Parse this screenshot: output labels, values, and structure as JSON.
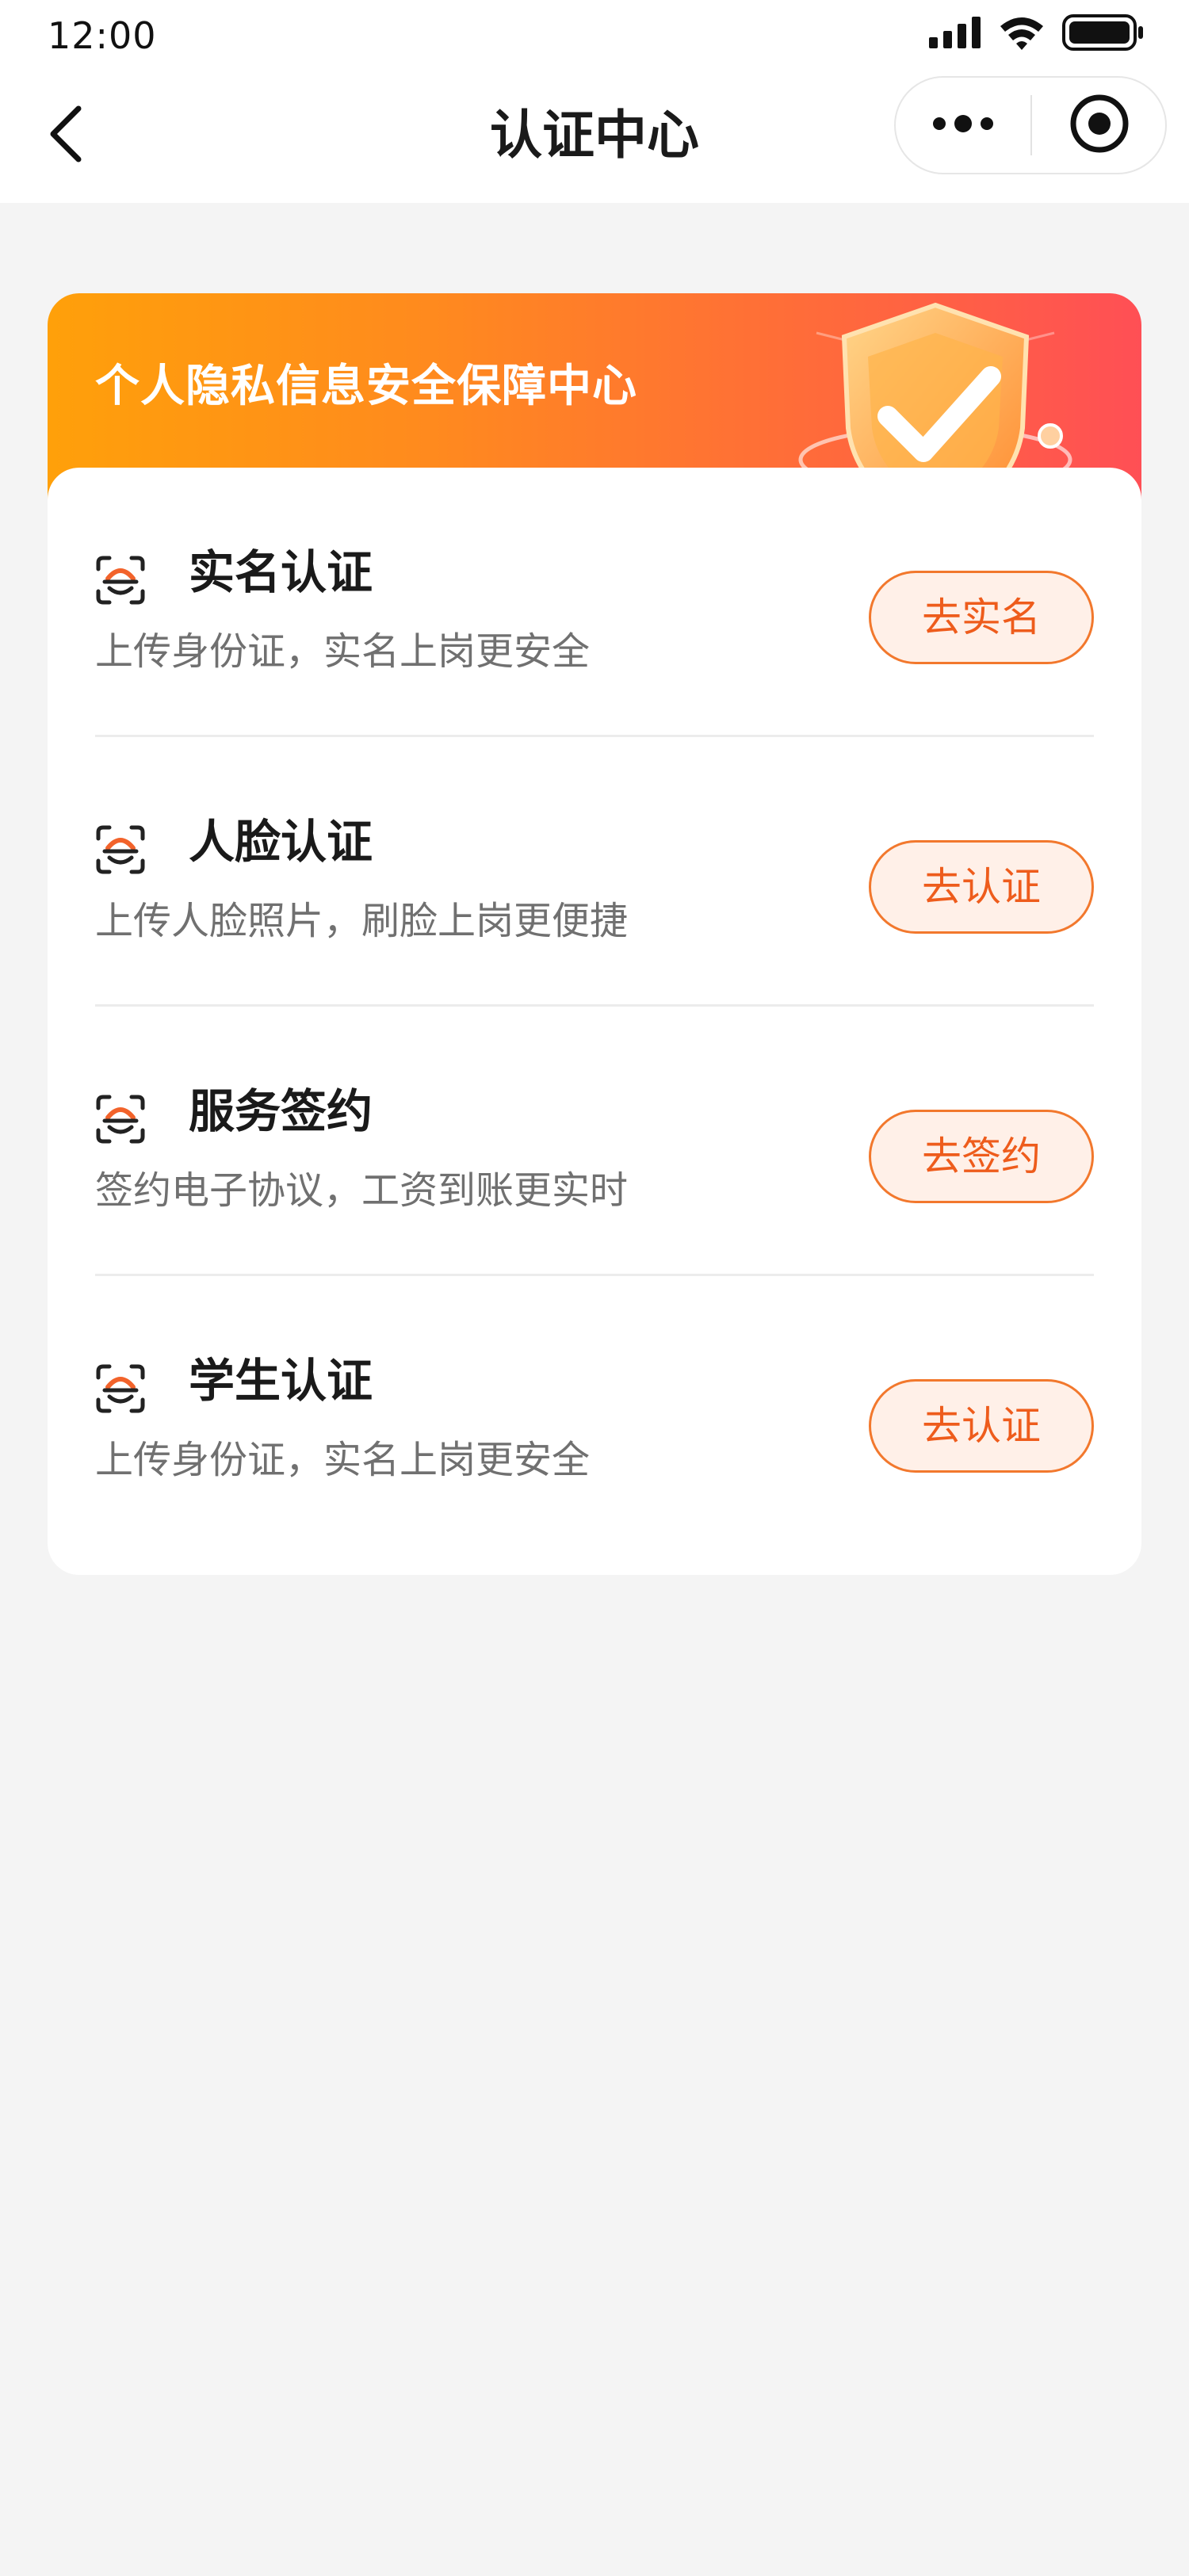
{
  "status_bar": {
    "time": "12:00",
    "icons": [
      "signal-icon",
      "wifi-icon",
      "battery-icon"
    ]
  },
  "nav": {
    "title": "认证中心",
    "back_icon": "chevron-left-icon",
    "more_icon": "more-dots-icon",
    "close_icon": "target-close-icon"
  },
  "banner": {
    "title": "个人隐私信息安全保障中心",
    "illustration": "shield-check-icon"
  },
  "items": [
    {
      "title": "实名认证",
      "desc": "上传身份证，实名上岗更安全",
      "button": "去实名",
      "icon": "scan-face-icon"
    },
    {
      "title": "人脸认证",
      "desc": "上传人脸照片，刷脸上岗更便捷",
      "button": "去认证",
      "icon": "scan-face-icon"
    },
    {
      "title": "服务签约",
      "desc": "签约电子协议，工资到账更实时",
      "button": "去签约",
      "icon": "scan-face-icon"
    },
    {
      "title": "学生认证",
      "desc": "上传身份证，实名上岗更安全",
      "button": "去认证",
      "icon": "scan-face-icon"
    }
  ],
  "colors": {
    "accent": "#ee5c1c",
    "banner_start": "#ffa00a",
    "banner_end": "#ff4f55",
    "button_bg": "#fff0e8",
    "page_bg": "#f4f4f4"
  }
}
